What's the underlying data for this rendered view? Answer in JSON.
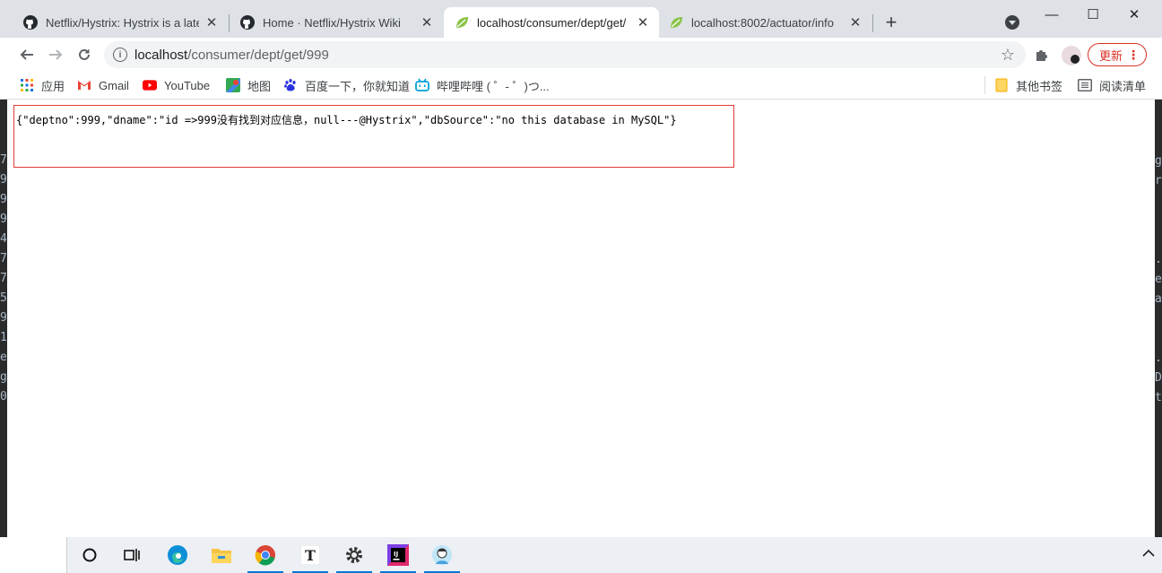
{
  "browser": {
    "tabs": [
      {
        "title": "Netflix/Hystrix: Hystrix is a late",
        "favicon": "github-icon",
        "active": false
      },
      {
        "title": "Home · Netflix/Hystrix Wiki",
        "favicon": "github-icon",
        "active": false
      },
      {
        "title": "localhost/consumer/dept/get/",
        "favicon": "spring-leaf-icon",
        "active": true
      },
      {
        "title": "localhost:8002/actuator/info",
        "favicon": "spring-leaf-icon",
        "active": false
      }
    ],
    "address_bar": {
      "host": "localhost",
      "path": "/consumer/dept/get/999"
    },
    "update_label": "更新",
    "bookmarks": [
      {
        "label": "应用",
        "icon": "apps-grid-icon"
      },
      {
        "label": "Gmail",
        "icon": "gmail-icon"
      },
      {
        "label": "YouTube",
        "icon": "youtube-icon"
      },
      {
        "label": "地图",
        "icon": "maps-icon"
      },
      {
        "label": "百度一下，你就知道",
        "icon": "baidu-paw-icon"
      },
      {
        "label": "哔哩哔哩 ( ゜- ゜)つ...",
        "icon": "bilibili-icon"
      }
    ],
    "bookmarks_right": [
      {
        "label": "其他书签",
        "icon": "folder-icon"
      },
      {
        "label": "阅读清单",
        "icon": "reading-list-icon"
      }
    ]
  },
  "page": {
    "json_text": "{\"deptno\":999,\"dname\":\"id =>999没有找到对应信息，null---@Hystrix\",\"dbSource\":\"no this database in MySQL\"}"
  },
  "background_editor": {
    "left_chars": [
      "7",
      "9",
      "9",
      "9",
      "4",
      "7",
      "7",
      "5",
      "9",
      "1",
      "e",
      "g",
      "0"
    ],
    "right_chars": [
      "g",
      "r",
      ".",
      "e",
      "a",
      ".",
      "D",
      "t"
    ]
  },
  "taskbar": {
    "items": [
      "cortana-icon",
      "task-view-icon",
      "edge-icon",
      "file-explorer-icon",
      "chrome-icon",
      "typora-icon",
      "settings-icon",
      "intellij-icon",
      "qq-avatar-icon"
    ]
  }
}
